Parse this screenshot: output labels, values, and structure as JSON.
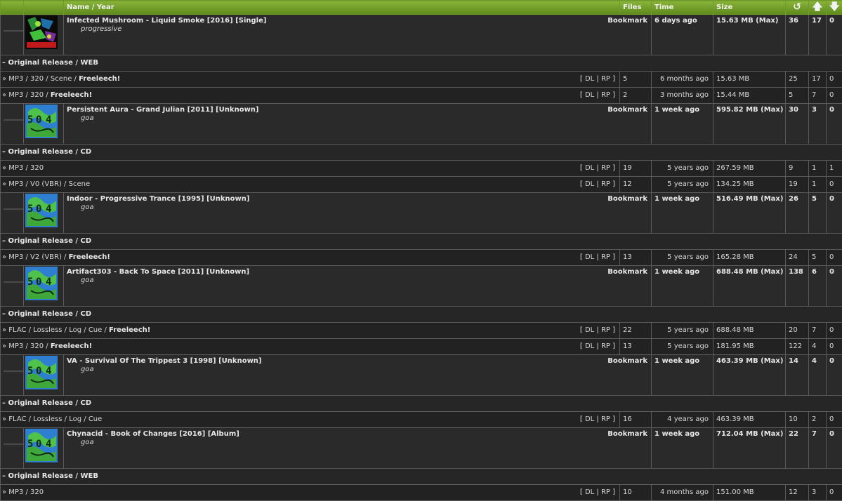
{
  "header": {
    "name_year": "Name / Year",
    "files": "Files",
    "time": "Time",
    "size": "Size",
    "snatched_icon": "↺",
    "seeders_icon": "🡅",
    "leechers_icon": "🡇"
  },
  "labels": {
    "bookmark": "Bookmark",
    "links": "[ DL | RP ]",
    "edition_prefix": "– "
  },
  "groups": [
    {
      "title": "Infected Mushroom - Liquid Smoke [2016] [Single]",
      "tag": "progressive",
      "time": "6 days ago",
      "size": "15.63 MB (Max)",
      "snatched": "36",
      "seeders": "17",
      "leechers": "0",
      "art": "red",
      "editions": [
        {
          "label": "Original Release / WEB",
          "torrents": [
            {
              "format": "» MP3 / 320 / Scene / ",
              "freeleech": "Freeleech!",
              "files": "5",
              "time": "6 months ago",
              "size": "15.63 MB",
              "snatched": "25",
              "seeders": "17",
              "leechers": "0"
            },
            {
              "format": "» MP3 / 320 / ",
              "freeleech": "Freeleech!",
              "files": "2",
              "time": "3 months ago",
              "size": "15.44 MB",
              "snatched": "5",
              "seeders": "7",
              "leechers": "0"
            }
          ]
        }
      ]
    },
    {
      "title": "Persistent Aura - Grand Julian [2011] [Unknown]",
      "tag": "goa",
      "time": "1 week ago",
      "size": "595.82 MB (Max)",
      "snatched": "30",
      "seeders": "3",
      "leechers": "0",
      "art": "goa",
      "editions": [
        {
          "label": "Original Release / CD",
          "torrents": [
            {
              "format": "» MP3 / 320",
              "freeleech": "",
              "files": "19",
              "time": "5 years ago",
              "size": "267.59 MB",
              "snatched": "9",
              "seeders": "1",
              "leechers": "1"
            },
            {
              "format": "» MP3 / V0 (VBR) / Scene",
              "freeleech": "",
              "files": "12",
              "time": "5 years ago",
              "size": "134.25 MB",
              "snatched": "19",
              "seeders": "1",
              "leechers": "0"
            }
          ]
        }
      ]
    },
    {
      "title": "Indoor - Progressive Trance [1995] [Unknown]",
      "tag": "goa",
      "time": "1 week ago",
      "size": "516.49 MB (Max)",
      "snatched": "26",
      "seeders": "5",
      "leechers": "0",
      "art": "goa",
      "editions": [
        {
          "label": "Original Release / CD",
          "torrents": [
            {
              "format": "» MP3 / V2 (VBR) / ",
              "freeleech": "Freeleech!",
              "files": "13",
              "time": "5 years ago",
              "size": "165.28 MB",
              "snatched": "24",
              "seeders": "5",
              "leechers": "0"
            }
          ]
        }
      ]
    },
    {
      "title": "Artifact303 - Back To Space [2011] [Unknown]",
      "tag": "goa",
      "time": "1 week ago",
      "size": "688.48 MB (Max)",
      "snatched": "138",
      "seeders": "6",
      "leechers": "0",
      "art": "goa",
      "editions": [
        {
          "label": "Original Release / CD",
          "torrents": [
            {
              "format": "» FLAC / Lossless / Log / Cue / ",
              "freeleech": "Freeleech!",
              "files": "22",
              "time": "5 years ago",
              "size": "688.48 MB",
              "snatched": "20",
              "seeders": "7",
              "leechers": "0"
            },
            {
              "format": "» MP3 / 320 / ",
              "freeleech": "Freeleech!",
              "files": "13",
              "time": "5 years ago",
              "size": "181.95 MB",
              "snatched": "122",
              "seeders": "4",
              "leechers": "0"
            }
          ]
        }
      ]
    },
    {
      "title": "VA - Survival Of The Trippest 3 [1998] [Unknown]",
      "tag": "goa",
      "time": "1 week ago",
      "size": "463.39 MB (Max)",
      "snatched": "14",
      "seeders": "4",
      "leechers": "0",
      "art": "goa",
      "editions": [
        {
          "label": "Original Release / CD",
          "torrents": [
            {
              "format": "» FLAC / Lossless / Log / Cue",
              "freeleech": "",
              "files": "16",
              "time": "4 years ago",
              "size": "463.39 MB",
              "snatched": "10",
              "seeders": "2",
              "leechers": "0"
            }
          ]
        }
      ]
    },
    {
      "title": "Chynacid - Book of Changes [2016] [Album]",
      "tag": "goa",
      "time": "1 week ago",
      "size": "712.04 MB (Max)",
      "snatched": "22",
      "seeders": "7",
      "leechers": "0",
      "art": "goa",
      "editions": [
        {
          "label": "Original Release / WEB",
          "torrents": [
            {
              "format": "» MP3 / 320",
              "freeleech": "",
              "files": "10",
              "time": "4 months ago",
              "size": "151.00 MB",
              "snatched": "12",
              "seeders": "3",
              "leechers": "0"
            }
          ]
        }
      ]
    }
  ]
}
